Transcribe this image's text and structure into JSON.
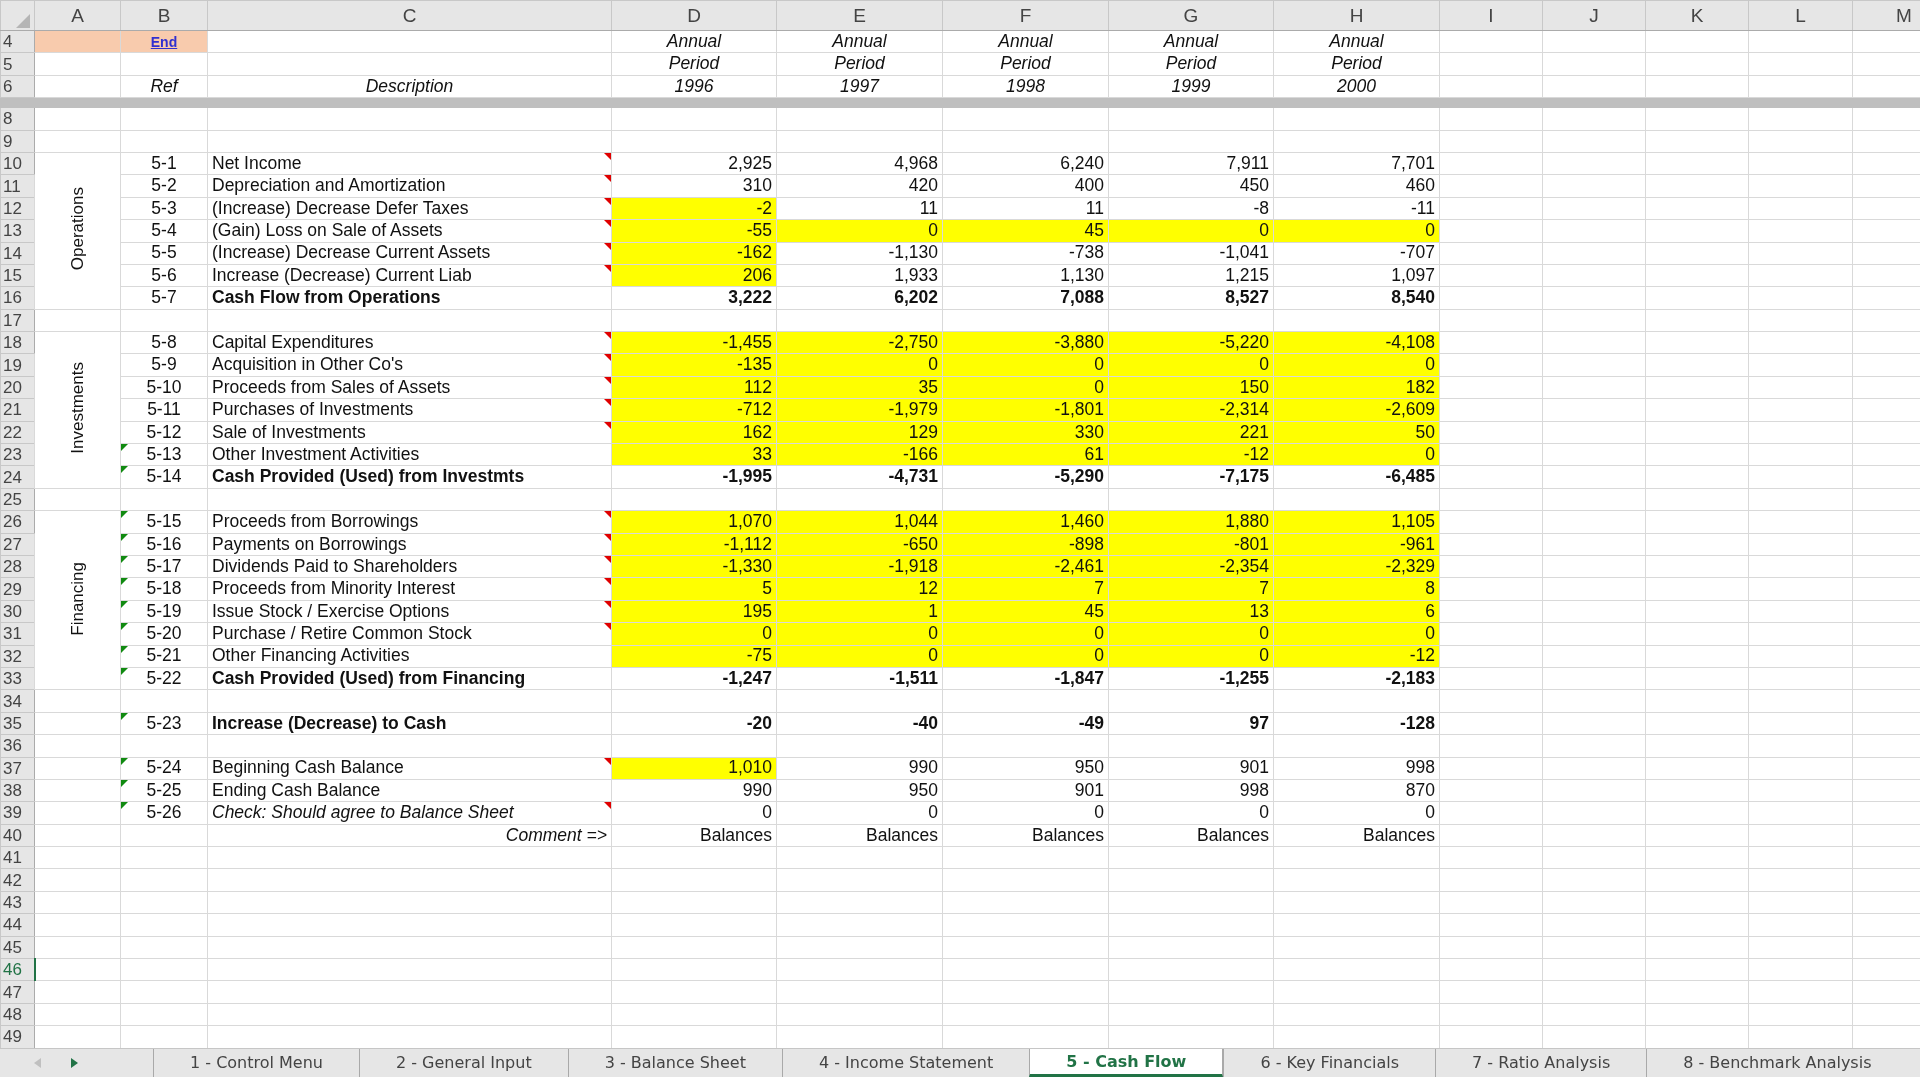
{
  "columns": [
    "A",
    "B",
    "C",
    "D",
    "E",
    "F",
    "G",
    "H",
    "I",
    "J",
    "K",
    "L",
    "M"
  ],
  "groups": [
    {
      "rows": [
        {
          "n": "4",
          "kind": "top",
          "link": "End",
          "selected": false,
          "cells": [
            "Annual",
            "Annual",
            "Annual",
            "Annual",
            "Annual"
          ]
        },
        {
          "n": "5",
          "kind": "head",
          "selected": false,
          "cells": [
            "Period",
            "Period",
            "Period",
            "Period",
            "Period"
          ]
        },
        {
          "n": "6",
          "kind": "head",
          "ref": "Ref",
          "text": "Description",
          "selected": false,
          "cells": [
            "1996",
            "1997",
            "1998",
            "1999",
            "2000"
          ]
        },
        {
          "kind": "band"
        },
        {
          "n": "8",
          "kind": "blank",
          "selected": false
        },
        {
          "n": "9",
          "kind": "blank",
          "selected": false
        }
      ]
    },
    {
      "label": "Operations",
      "rows": [
        {
          "n": "10",
          "kind": "line",
          "ref": "5-1",
          "text": "Net Income",
          "flag": false,
          "comment": true,
          "selected": false,
          "cells": [
            {
              "v": "2,925",
              "input": false
            },
            {
              "v": "4,968",
              "input": false
            },
            {
              "v": "6,240",
              "input": false
            },
            {
              "v": "7,911",
              "input": false
            },
            {
              "v": "7,701",
              "input": false
            }
          ]
        },
        {
          "n": "11",
          "kind": "line",
          "ref": "5-2",
          "text": "Depreciation and Amortization",
          "flag": false,
          "comment": true,
          "selected": false,
          "cells": [
            {
              "v": "310",
              "input": false
            },
            {
              "v": "420",
              "input": false
            },
            {
              "v": "400",
              "input": false
            },
            {
              "v": "450",
              "input": false
            },
            {
              "v": "460",
              "input": false
            }
          ]
        },
        {
          "n": "12",
          "kind": "line",
          "ref": "5-3",
          "text": "(Increase) Decrease Defer Taxes",
          "flag": false,
          "comment": true,
          "selected": false,
          "cells": [
            {
              "v": "-2",
              "input": true
            },
            {
              "v": "11",
              "input": false
            },
            {
              "v": "11",
              "input": false
            },
            {
              "v": "-8",
              "input": false
            },
            {
              "v": "-11",
              "input": false
            }
          ]
        },
        {
          "n": "13",
          "kind": "line",
          "ref": "5-4",
          "text": "(Gain) Loss on Sale of Assets",
          "flag": false,
          "comment": true,
          "selected": false,
          "cells": [
            {
              "v": "-55",
              "input": true
            },
            {
              "v": "0",
              "input": true
            },
            {
              "v": "45",
              "input": true
            },
            {
              "v": "0",
              "input": true
            },
            {
              "v": "0",
              "input": true
            }
          ]
        },
        {
          "n": "14",
          "kind": "line",
          "ref": "5-5",
          "text": "(Increase) Decrease Current Assets",
          "flag": false,
          "comment": true,
          "selected": false,
          "cells": [
            {
              "v": "-162",
              "input": true
            },
            {
              "v": "-1,130",
              "input": false
            },
            {
              "v": "-738",
              "input": false
            },
            {
              "v": "-1,041",
              "input": false
            },
            {
              "v": "-707",
              "input": false
            }
          ]
        },
        {
          "n": "15",
          "kind": "line",
          "ref": "5-6",
          "text": "Increase (Decrease) Current Liab",
          "flag": false,
          "comment": true,
          "selected": false,
          "cells": [
            {
              "v": "206",
              "input": true
            },
            {
              "v": "1,933",
              "input": false
            },
            {
              "v": "1,130",
              "input": false
            },
            {
              "v": "1,215",
              "input": false
            },
            {
              "v": "1,097",
              "input": false
            }
          ]
        },
        {
          "n": "16",
          "kind": "total",
          "ref": "5-7",
          "text": "Cash Flow from Operations",
          "flag": false,
          "comment": false,
          "selected": false,
          "cells": [
            {
              "v": "3,222",
              "input": false
            },
            {
              "v": "6,202",
              "input": false
            },
            {
              "v": "7,088",
              "input": false
            },
            {
              "v": "8,527",
              "input": false
            },
            {
              "v": "8,540",
              "input": false
            }
          ]
        }
      ]
    },
    {
      "rows": [
        {
          "n": "17",
          "kind": "blank",
          "selected": false
        }
      ]
    },
    {
      "label": "Investments",
      "rows": [
        {
          "n": "18",
          "kind": "line",
          "ref": "5-8",
          "text": "Capital Expenditures",
          "flag": false,
          "comment": true,
          "selected": false,
          "cells": [
            {
              "v": "-1,455",
              "input": true
            },
            {
              "v": "-2,750",
              "input": true
            },
            {
              "v": "-3,880",
              "input": true
            },
            {
              "v": "-5,220",
              "input": true
            },
            {
              "v": "-4,108",
              "input": true
            }
          ]
        },
        {
          "n": "19",
          "kind": "line",
          "ref": "5-9",
          "text": "Acquisition in Other Co's",
          "flag": false,
          "comment": true,
          "selected": false,
          "cells": [
            {
              "v": "-135",
              "input": true
            },
            {
              "v": "0",
              "input": true
            },
            {
              "v": "0",
              "input": true
            },
            {
              "v": "0",
              "input": true
            },
            {
              "v": "0",
              "input": true
            }
          ]
        },
        {
          "n": "20",
          "kind": "line",
          "ref": "5-10",
          "text": "Proceeds from Sales of Assets",
          "flag": false,
          "comment": true,
          "selected": false,
          "cells": [
            {
              "v": "112",
              "input": true
            },
            {
              "v": "35",
              "input": true
            },
            {
              "v": "0",
              "input": true
            },
            {
              "v": "150",
              "input": true
            },
            {
              "v": "182",
              "input": true
            }
          ]
        },
        {
          "n": "21",
          "kind": "line",
          "ref": "5-11",
          "text": "Purchases of Investments",
          "flag": false,
          "comment": true,
          "selected": false,
          "cells": [
            {
              "v": "-712",
              "input": true
            },
            {
              "v": "-1,979",
              "input": true
            },
            {
              "v": "-1,801",
              "input": true
            },
            {
              "v": "-2,314",
              "input": true
            },
            {
              "v": "-2,609",
              "input": true
            }
          ]
        },
        {
          "n": "22",
          "kind": "line",
          "ref": "5-12",
          "text": "Sale of Investments",
          "flag": false,
          "comment": true,
          "selected": false,
          "cells": [
            {
              "v": "162",
              "input": true
            },
            {
              "v": "129",
              "input": true
            },
            {
              "v": "330",
              "input": true
            },
            {
              "v": "221",
              "input": true
            },
            {
              "v": "50",
              "input": true
            }
          ]
        },
        {
          "n": "23",
          "kind": "line",
          "ref": "5-13",
          "text": "Other Investment Activities",
          "flag": true,
          "comment": false,
          "selected": false,
          "cells": [
            {
              "v": "33",
              "input": true
            },
            {
              "v": "-166",
              "input": true
            },
            {
              "v": "61",
              "input": true
            },
            {
              "v": "-12",
              "input": true
            },
            {
              "v": "0",
              "input": true
            }
          ]
        },
        {
          "n": "24",
          "kind": "total",
          "ref": "5-14",
          "text": "Cash Provided (Used) from Investmts",
          "flag": true,
          "comment": false,
          "selected": false,
          "cells": [
            {
              "v": "-1,995",
              "input": false
            },
            {
              "v": "-4,731",
              "input": false
            },
            {
              "v": "-5,290",
              "input": false
            },
            {
              "v": "-7,175",
              "input": false
            },
            {
              "v": "-6,485",
              "input": false
            }
          ]
        }
      ]
    },
    {
      "rows": [
        {
          "n": "25",
          "kind": "blank",
          "selected": false
        }
      ]
    },
    {
      "label": "Financing",
      "rows": [
        {
          "n": "26",
          "kind": "line",
          "ref": "5-15",
          "text": "Proceeds from Borrowings",
          "flag": true,
          "comment": true,
          "selected": false,
          "cells": [
            {
              "v": "1,070",
              "input": true
            },
            {
              "v": "1,044",
              "input": true
            },
            {
              "v": "1,460",
              "input": true
            },
            {
              "v": "1,880",
              "input": true
            },
            {
              "v": "1,105",
              "input": true
            }
          ]
        },
        {
          "n": "27",
          "kind": "line",
          "ref": "5-16",
          "text": "Payments on Borrowings",
          "flag": true,
          "comment": true,
          "selected": false,
          "cells": [
            {
              "v": "-1,112",
              "input": true
            },
            {
              "v": "-650",
              "input": true
            },
            {
              "v": "-898",
              "input": true
            },
            {
              "v": "-801",
              "input": true
            },
            {
              "v": "-961",
              "input": true
            }
          ]
        },
        {
          "n": "28",
          "kind": "line",
          "ref": "5-17",
          "text": "Dividends Paid to Shareholders",
          "flag": true,
          "comment": true,
          "selected": false,
          "cells": [
            {
              "v": "-1,330",
              "input": true
            },
            {
              "v": "-1,918",
              "input": true
            },
            {
              "v": "-2,461",
              "input": true
            },
            {
              "v": "-2,354",
              "input": true
            },
            {
              "v": "-2,329",
              "input": true
            }
          ]
        },
        {
          "n": "29",
          "kind": "line",
          "ref": "5-18",
          "text": "Proceeds from Minority Interest",
          "flag": true,
          "comment": true,
          "selected": false,
          "cells": [
            {
              "v": "5",
              "input": true
            },
            {
              "v": "12",
              "input": true
            },
            {
              "v": "7",
              "input": true
            },
            {
              "v": "7",
              "input": true
            },
            {
              "v": "8",
              "input": true
            }
          ]
        },
        {
          "n": "30",
          "kind": "line",
          "ref": "5-19",
          "text": "Issue Stock / Exercise Options",
          "flag": true,
          "comment": true,
          "selected": false,
          "cells": [
            {
              "v": "195",
              "input": true
            },
            {
              "v": "1",
              "input": true
            },
            {
              "v": "45",
              "input": true
            },
            {
              "v": "13",
              "input": true
            },
            {
              "v": "6",
              "input": true
            }
          ]
        },
        {
          "n": "31",
          "kind": "line",
          "ref": "5-20",
          "text": "Purchase / Retire Common Stock",
          "flag": true,
          "comment": true,
          "selected": false,
          "cells": [
            {
              "v": "0",
              "input": true
            },
            {
              "v": "0",
              "input": true
            },
            {
              "v": "0",
              "input": true
            },
            {
              "v": "0",
              "input": true
            },
            {
              "v": "0",
              "input": true
            }
          ]
        },
        {
          "n": "32",
          "kind": "line",
          "ref": "5-21",
          "text": "Other Financing Activities",
          "flag": true,
          "comment": false,
          "selected": false,
          "cells": [
            {
              "v": "-75",
              "input": true
            },
            {
              "v": "0",
              "input": true
            },
            {
              "v": "0",
              "input": true
            },
            {
              "v": "0",
              "input": true
            },
            {
              "v": "-12",
              "input": true
            }
          ]
        },
        {
          "n": "33",
          "kind": "total",
          "ref": "5-22",
          "text": "Cash Provided (Used) from Financing",
          "flag": true,
          "comment": false,
          "selected": false,
          "cells": [
            {
              "v": "-1,247",
              "input": false
            },
            {
              "v": "-1,511",
              "input": false
            },
            {
              "v": "-1,847",
              "input": false
            },
            {
              "v": "-1,255",
              "input": false
            },
            {
              "v": "-2,183",
              "input": false
            }
          ]
        }
      ]
    },
    {
      "rows": [
        {
          "n": "34",
          "kind": "blank",
          "selected": false
        },
        {
          "n": "35",
          "kind": "total",
          "ref": "5-23",
          "text": "Increase (Decrease) to Cash",
          "flag": true,
          "comment": false,
          "selected": false,
          "cells": [
            {
              "v": "-20",
              "input": false
            },
            {
              "v": "-40",
              "input": false
            },
            {
              "v": "-49",
              "input": false
            },
            {
              "v": "97",
              "input": false
            },
            {
              "v": "-128",
              "input": false
            }
          ]
        },
        {
          "n": "36",
          "kind": "blank",
          "selected": false
        },
        {
          "n": "37",
          "kind": "line",
          "ref": "5-24",
          "text": "Beginning Cash Balance",
          "flag": true,
          "comment": true,
          "selected": false,
          "cells": [
            {
              "v": "1,010",
              "input": true
            },
            {
              "v": "990",
              "input": false
            },
            {
              "v": "950",
              "input": false
            },
            {
              "v": "901",
              "input": false
            },
            {
              "v": "998",
              "input": false
            }
          ]
        },
        {
          "n": "38",
          "kind": "line",
          "ref": "5-25",
          "text": "Ending Cash Balance",
          "flag": true,
          "comment": false,
          "selected": false,
          "cells": [
            {
              "v": "990",
              "input": false
            },
            {
              "v": "950",
              "input": false
            },
            {
              "v": "901",
              "input": false
            },
            {
              "v": "998",
              "input": false
            },
            {
              "v": "870",
              "input": false
            }
          ]
        },
        {
          "n": "39",
          "kind": "check",
          "ref": "5-26",
          "text": "Check: Should agree to Balance Sheet",
          "flag": true,
          "comment": true,
          "selected": false,
          "cells": [
            {
              "v": "0",
              "input": false
            },
            {
              "v": "0",
              "input": false
            },
            {
              "v": "0",
              "input": false
            },
            {
              "v": "0",
              "input": false
            },
            {
              "v": "0",
              "input": false
            }
          ]
        },
        {
          "n": "40",
          "kind": "comment",
          "text": "Comment =>",
          "selected": false,
          "cells": [
            "Balances",
            "Balances",
            "Balances",
            "Balances",
            "Balances"
          ]
        },
        {
          "n": "41",
          "kind": "blank",
          "selected": false
        },
        {
          "n": "42",
          "kind": "blank",
          "selected": false
        },
        {
          "n": "43",
          "kind": "blank",
          "selected": false
        },
        {
          "n": "44",
          "kind": "blank",
          "selected": false
        },
        {
          "n": "45",
          "kind": "blank",
          "selected": false
        },
        {
          "n": "46",
          "kind": "blank",
          "selected": true
        },
        {
          "n": "47",
          "kind": "blank",
          "selected": false
        },
        {
          "n": "48",
          "kind": "blank",
          "selected": false
        },
        {
          "n": "49",
          "kind": "blank",
          "selected": false
        }
      ]
    }
  ],
  "scroll_buttons": [
    {
      "kind": "left",
      "disabled": true
    },
    {
      "kind": "right",
      "disabled": false
    }
  ],
  "sheet_tabs": [
    {
      "label": "1 - Control Menu",
      "selected": false
    },
    {
      "label": "2 - General Input",
      "selected": false
    },
    {
      "label": "3 - Balance Sheet",
      "selected": false
    },
    {
      "label": "4 - Income Statement",
      "selected": false
    },
    {
      "label": "5 - Cash Flow",
      "selected": true
    },
    {
      "label": "6 - Key Financials",
      "selected": false
    },
    {
      "label": "7 - Ratio Analysis",
      "selected": false
    },
    {
      "label": "8 - Benchmark Analysis",
      "selected": false
    }
  ]
}
